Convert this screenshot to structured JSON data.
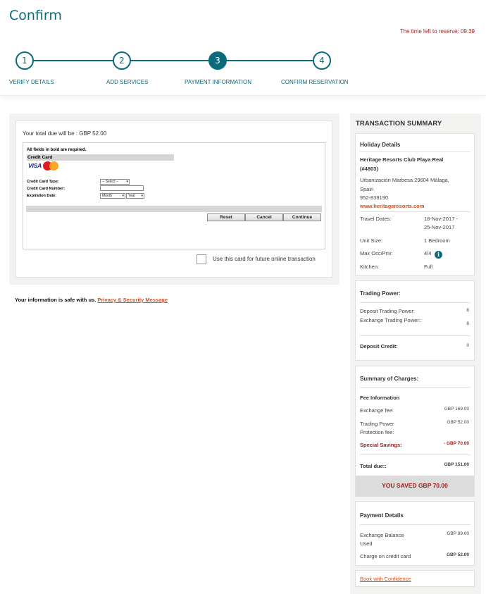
{
  "header": {
    "title": "Confirm",
    "timer_label": "The time left to reserve:",
    "timer_value": "09:39"
  },
  "steps": [
    {
      "number": "1",
      "label": "VERIFY DETAILS",
      "active": false
    },
    {
      "number": "2",
      "label": "ADD SERVICES",
      "active": false
    },
    {
      "number": "3",
      "label": "PAYMENT INFORMATION",
      "active": true
    },
    {
      "number": "4",
      "label": "CONFIRM RESERVATION",
      "active": false
    }
  ],
  "payment": {
    "total_due_text": "Your total due will be : GBP 52.00",
    "required_note": "All fields in bold are required.",
    "section_title": "Credit Card",
    "card_brands": [
      "VISA",
      "MasterCard"
    ],
    "card_type_label": "Credit Card Type:",
    "card_type_value": "-- Select --",
    "card_number_label": "Credit Card Number:",
    "card_number_value": "",
    "expiration_label": "Expiration Date:",
    "exp_month_value": "Month",
    "exp_year_value": "Year",
    "buttons": {
      "reset": "Reset",
      "cancel": "Cancel",
      "continue": "Continue"
    },
    "future_use_label": "Use this card for future online transaction",
    "future_use_checked": false
  },
  "security": {
    "message": "Your information is safe with us.",
    "link": "Privacy & Security Message"
  },
  "summary": {
    "title": "TRANSACTION SUMMARY",
    "holiday": {
      "heading": "Holiday Details",
      "resort_name_line1": "Heritage Resorts Club Playa Real",
      "resort_name_line2": "(#4803)",
      "address_line1": "Urbanización Marbesa 29604 Málaga,",
      "address_line2": "Spain",
      "phone": "952-839190",
      "website": "www.heritageresorts.com",
      "travel_dates_label": "Travel Dates:",
      "travel_dates_line1": "18-Nov-2017 -",
      "travel_dates_line2": "25-Nov-2017",
      "unit_size_label": "Unit Size:",
      "unit_size_value": "1  Bedroom",
      "max_occ_label": "Max Occ/Priv:",
      "max_occ_value": "4/4",
      "kitchen_label": "Kitchen:",
      "kitchen_value": "Full"
    },
    "trading": {
      "heading": "Trading Power:",
      "deposit_label": "Deposit Trading Power:",
      "deposit_value": "8",
      "exchange_label": "Exchange Trading Power::",
      "exchange_value": "8",
      "credit_label": "Deposit Credit:",
      "credit_value": "0"
    },
    "charges": {
      "heading": "Summary of Charges:",
      "fee_info_label": "Fee Information",
      "exchange_fee_label": "Exchange fee:",
      "exchange_fee_value": "GBP 169.00",
      "tp_fee_label_line1": "Trading Power",
      "tp_fee_label_line2": "Protection fee:",
      "tp_fee_value": "GBP 52.00",
      "savings_label": "Special Savings:",
      "savings_value": "- GBP 70.00",
      "total_label": "Total due::",
      "total_value": "GBP 151.00",
      "saved_banner": "YOU SAVED GBP 70.00"
    },
    "payment_details": {
      "heading": "Payment Details",
      "balance_label_line1": "Exchange Balance",
      "balance_label_line2": "Used",
      "balance_value": "GBP 99.00",
      "charge_label": "Charge on credit card",
      "charge_value": "GBP 52.00"
    },
    "book_link": "Book with Confidence"
  },
  "colors": {
    "accent": "#0b6b7a",
    "alert_red": "#9b1b1b",
    "link_orange": "#d4501f"
  }
}
